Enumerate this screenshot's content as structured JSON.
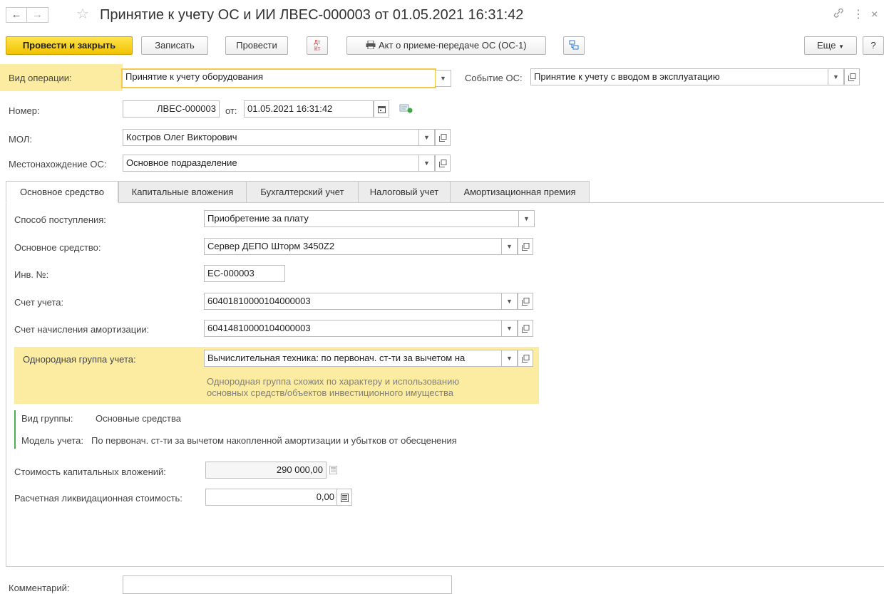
{
  "header": {
    "title": "Принятие к учету ОС и ИИ ЛВЕС-000003 от 01.05.2021 16:31:42",
    "back_icon": "←",
    "forward_icon": "→",
    "star_icon": "☆",
    "link_icon": "⛓",
    "more_icon": "⋮",
    "close_icon": "×"
  },
  "toolbar": {
    "post_close": "Провести и закрыть",
    "save": "Записать",
    "post": "Провести",
    "dtkt": "Дт Кт",
    "print_act": "Акт о приеме-передаче ОС (ОС-1)",
    "more": "Еще",
    "help": "?"
  },
  "form": {
    "op_type_label": "Вид операции:",
    "op_type_value": "Принятие к учету оборудования",
    "event_label": "Событие ОС:",
    "event_value": "Принятие к учету с вводом в эксплуатацию",
    "number_label": "Номер:",
    "number_value": "ЛВЕС-000003",
    "from_label": "от:",
    "date_value": "01.05.2021 16:31:42",
    "mol_label": "МОЛ:",
    "mol_value": "Костров Олег Викторович",
    "location_label": "Местонахождение ОС:",
    "location_value": "Основное подразделение",
    "comment_label": "Комментарий:",
    "comment_value": ""
  },
  "tabs": [
    {
      "label": "Основное средство",
      "active": true
    },
    {
      "label": "Капитальные вложения",
      "active": false
    },
    {
      "label": "Бухгалтерский учет",
      "active": false
    },
    {
      "label": "Налоговый учет",
      "active": false
    },
    {
      "label": "Амортизационная премия",
      "active": false
    }
  ],
  "asset": {
    "receipt_label": "Способ поступления:",
    "receipt_value": "Приобретение за плату",
    "asset_label": "Основное средство:",
    "asset_value": "Сервер ДЕПО Шторм 3450Z2",
    "inv_label": "Инв. №:",
    "inv_value": "ЕС-000003",
    "account_label": "Счет учета:",
    "account_value": "60401810000104000003",
    "depr_account_label": "Счет начисления амортизации:",
    "depr_account_value": "60414810000104000003",
    "group_label": "Однородная группа учета:",
    "group_value": "Вычислительная техника: по первонач. ст-ти за вычетом на",
    "group_hint_1": "Однородная группа схожих по характеру и использованию",
    "group_hint_2": "основных средств/объектов инвестиционного имущества",
    "group_type_label": "Вид  группы:",
    "group_type_value": "Основные средства",
    "model_label": "Модель учета:",
    "model_value": "По первонач. ст-ти за вычетом накопленной амортизации и убытков от обесценения",
    "capital_cost_label": "Стоимость капитальных вложений:",
    "capital_cost_value": "290 000,00",
    "salvage_label": "Расчетная ликвидационная стоимость:",
    "salvage_value": "0,00"
  },
  "colors": {
    "accent_yellow": "#f2c200",
    "highlight_bg": "#fbeca1",
    "green_bar": "#4caf50"
  }
}
